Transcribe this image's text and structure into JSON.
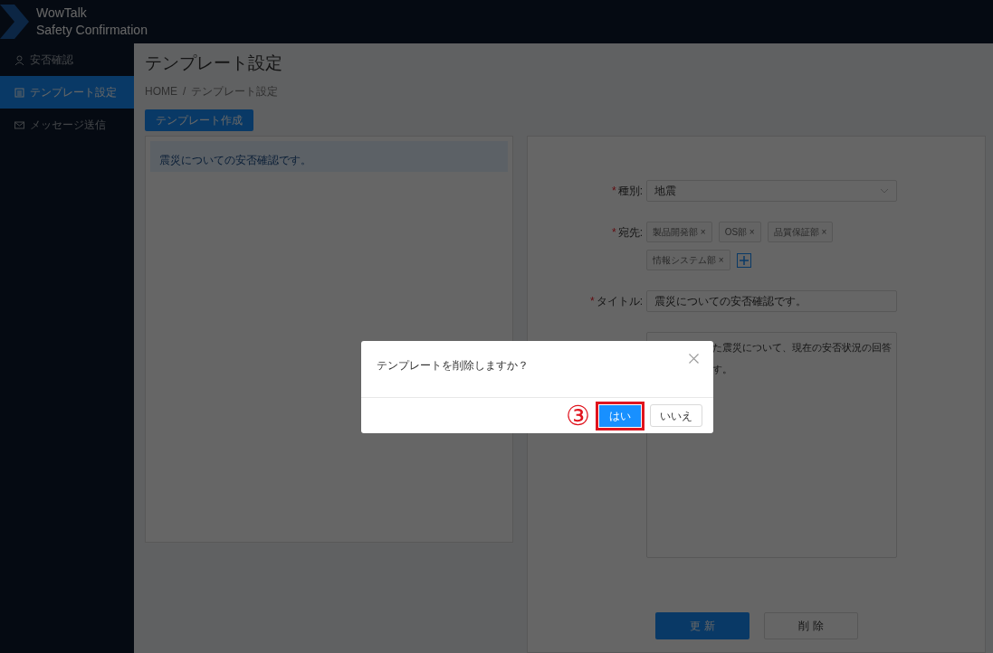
{
  "header": {
    "brand_line1": "WowTalk",
    "brand_line2": "Safety Confirmation"
  },
  "sidebar": {
    "items": [
      {
        "label": "安否確認",
        "kind": "person",
        "selected": false
      },
      {
        "label": "テンプレート設定",
        "kind": "table",
        "selected": true
      },
      {
        "label": "メッセージ送信",
        "kind": "mail",
        "selected": false
      }
    ]
  },
  "page": {
    "title": "テンプレート設定",
    "breadcrumb": [
      "HOME",
      "テンプレート設定"
    ],
    "breadcrumb_separator": "/",
    "create_button": "テンプレート作成"
  },
  "template_list": {
    "items": [
      {
        "label": "震災についての安否確認です。",
        "selected": true
      }
    ]
  },
  "form": {
    "type": {
      "required_mark": "*",
      "label": "種別:",
      "value": "地震"
    },
    "recipients": {
      "required_mark": "*",
      "label": "宛先:",
      "tags": [
        "製品開発部 ×",
        "OS部 ×",
        "品質保証部 ×",
        "情報システム部 ×"
      ]
    },
    "title": {
      "required_mark": "*",
      "label": "タイトル:",
      "value": "震災についての安否確認です。"
    },
    "body": {
      "visible_lines": [
        "た震災について、現在の安否状況の回答",
        "す。"
      ]
    },
    "update_button": "更 新",
    "delete_button": "削 除"
  },
  "dialog": {
    "message": "テンプレートを削除しますか？",
    "confirm_button": "はい",
    "cancel_button": "いいえ",
    "step_marker": "③",
    "confirm_highlighted": true
  }
}
